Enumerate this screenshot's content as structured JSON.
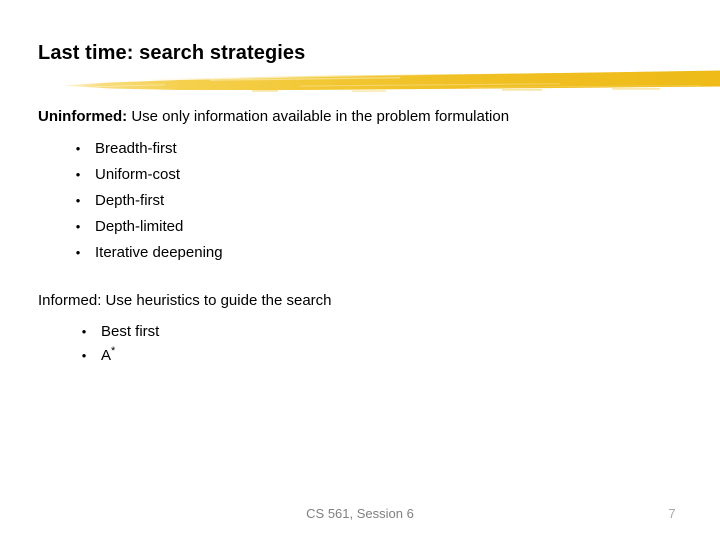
{
  "slide": {
    "title": "Last time: search strategies",
    "accent_color": "#F0BE22",
    "background_color": "#FFFFFF",
    "text_color": "#000000",
    "footer_color": "#808080"
  },
  "uninformed": {
    "label": "Uninformed:",
    "description": " Use only information available in the problem formulation",
    "bullet_glyph": "•",
    "items": [
      {
        "label": "Breadth-first"
      },
      {
        "label": "Uniform-cost"
      },
      {
        "label": "Depth-first"
      },
      {
        "label": "Depth-limited"
      },
      {
        "label": "Iterative deepening"
      }
    ]
  },
  "informed": {
    "label": "Informed:",
    "description": " Use heuristics to guide the search",
    "bullet_glyph": "•",
    "items": [
      {
        "label": "Best first"
      },
      {
        "label": "A",
        "superscript": "*"
      }
    ]
  },
  "footer": {
    "center_text": "CS 561, Session 6",
    "page_number": "7"
  }
}
